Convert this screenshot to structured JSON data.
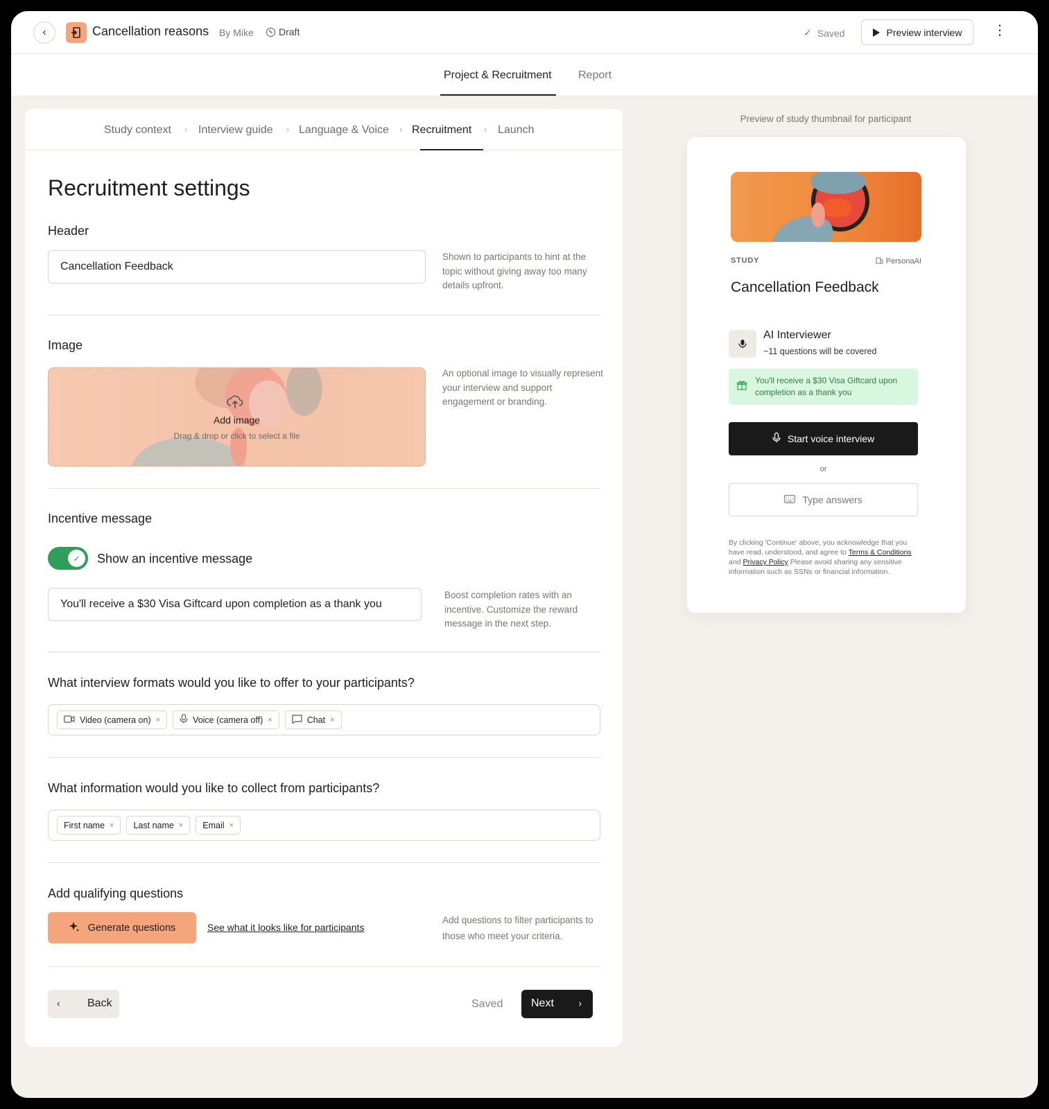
{
  "topbar": {
    "project_title": "Cancellation reasons",
    "author": "By Mike",
    "status": "Draft",
    "saved": "Saved",
    "preview_button": "Preview interview"
  },
  "main_tabs": [
    {
      "label": "Project & Recruitment",
      "active": true
    },
    {
      "label": "Report",
      "active": false
    }
  ],
  "steps": [
    {
      "label": "Study context"
    },
    {
      "label": "Interview guide"
    },
    {
      "label": "Language & Voice"
    },
    {
      "label": "Recruitment",
      "active": true
    },
    {
      "label": "Launch"
    }
  ],
  "form": {
    "title": "Recruitment settings",
    "header": {
      "label": "Header",
      "value": "Cancellation Feedback",
      "hint": "Shown to participants to hint at the topic without giving away too many details upfront."
    },
    "image": {
      "label": "Image",
      "drop_title": "Add image",
      "drop_sub": "Drag & drop or click to select a file",
      "hint": "An optional image to visually represent your interview and support engagement or branding."
    },
    "incentive": {
      "label": "Incentive message",
      "toggle_label": "Show an incentive message",
      "toggle_on": true,
      "value": "You'll receive a $30 Visa Giftcard upon completion as a thank you",
      "hint": "Boost completion rates with an incentive. Customize the reward message in the next step."
    },
    "formats": {
      "label": "What interview formats would you like to offer to your participants?",
      "tags": [
        {
          "label": "Video (camera on)",
          "icon": "video-icon"
        },
        {
          "label": "Voice (camera off)",
          "icon": "mic-icon"
        },
        {
          "label": "Chat",
          "icon": "chat-icon"
        }
      ]
    },
    "collect": {
      "label": "What information would you like to collect from participants?",
      "tags": [
        "First name",
        "Last name",
        "Email"
      ]
    },
    "qualifying": {
      "label": "Add qualifying questions",
      "generate_button": "Generate questions",
      "link": "See what it looks like for participants",
      "hint": "Add questions to filter participants to those who meet your criteria."
    },
    "footer": {
      "back": "Back",
      "saved": "Saved",
      "next": "Next"
    }
  },
  "preview": {
    "caption": "Preview of study thumbnail for participant",
    "tag": "STUDY",
    "org": "PersonaAI",
    "title": "Cancellation Feedback",
    "ai_name": "AI Interviewer",
    "ai_sub": "~11 questions will be covered",
    "incentive": "You'll receive a $30 Visa Giftcard upon completion as a thank you",
    "start_button": "Start voice interview",
    "or": "or",
    "type_button": "Type answers",
    "legal_pre": "By clicking 'Continue' above, you acknowledge that you have read, understood, and agree to",
    "legal_terms": "Terms & Conditions",
    "legal_and": "and",
    "legal_privacy": "Privacy Policy",
    "legal_post": "Please avoid sharing any sensitive information such as SSNs or financial information."
  },
  "colors": {
    "accent": "#f4a57c",
    "success": "#2f9e5a",
    "dark": "#1a1a1a",
    "background": "#f4f0eb"
  }
}
